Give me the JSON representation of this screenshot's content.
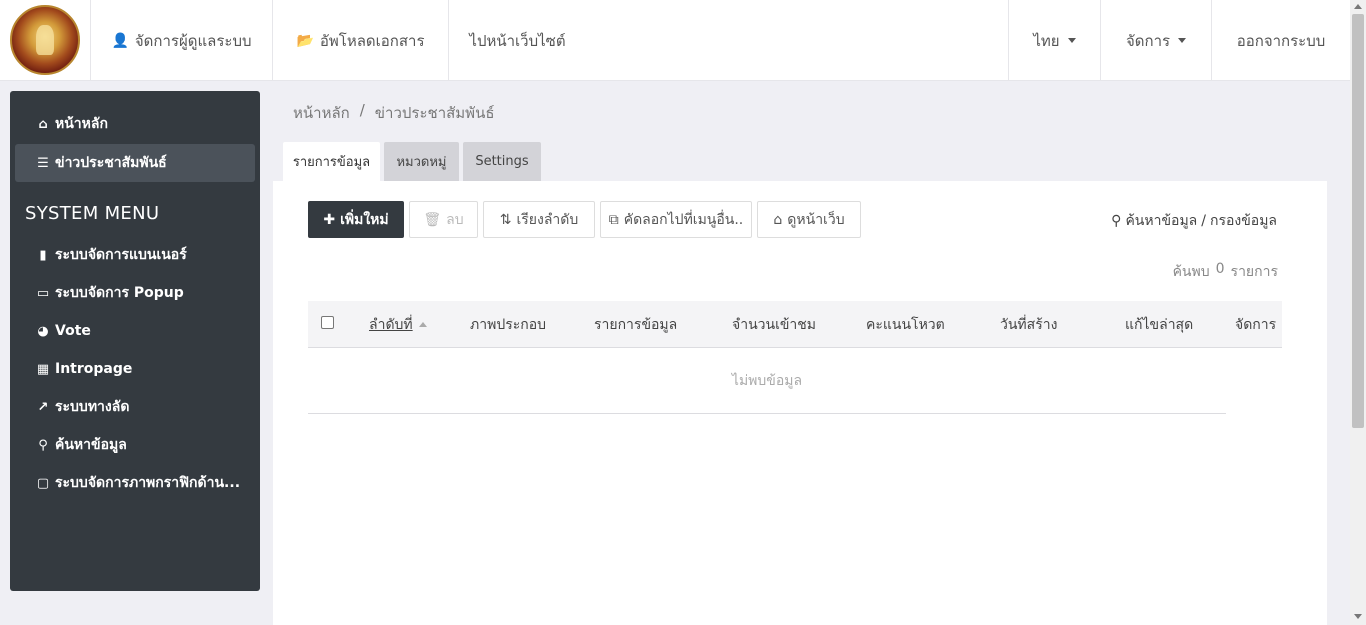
{
  "header": {
    "nav": [
      {
        "label": "จัดการผู้ดูแลระบบ",
        "icon": "user-icon"
      },
      {
        "label": "อัพโหลดเอกสาร",
        "icon": "folder-open-icon"
      },
      {
        "label": "ไปหน้าเว็บไซต์"
      }
    ],
    "language": "ไทย",
    "manage": "จัดการ",
    "logout": "ออกจากระบบ"
  },
  "sidebar": {
    "top_items": [
      {
        "label": "หน้าหลัก",
        "icon": "home-icon"
      },
      {
        "label": "ข่าวประชาสัมพันธ์",
        "icon": "bars-icon"
      }
    ],
    "heading": "SYSTEM MENU",
    "menu_items": [
      {
        "label": "ระบบจัดการแบนเนอร์",
        "icon": "bookmark-icon"
      },
      {
        "label": "ระบบจัดการ Popup",
        "icon": "laptop-icon"
      },
      {
        "label": "Vote",
        "icon": "pie-chart-icon"
      },
      {
        "label": "Intropage",
        "icon": "image-icon"
      },
      {
        "label": "ระบบทางลัด",
        "icon": "external-link-icon"
      },
      {
        "label": "ค้นหาข้อมูล",
        "icon": "search-icon"
      },
      {
        "label": "ระบบจัดการภาพกราฟิกด้าน...",
        "icon": "desktop-icon"
      }
    ]
  },
  "breadcrumb": {
    "home": "หน้าหลัก",
    "separator": "/",
    "current": "ข่าวประชาสัมพันธ์"
  },
  "tabs": [
    "รายการข้อมูล",
    "หมวดหมู่",
    "Settings"
  ],
  "toolbar": {
    "add": "เพิ่มใหม่",
    "delete": "ลบ",
    "sort": "เรียงลำดับ",
    "copy": "คัดลอกไปที่เมนูอื่น..",
    "view": "ดูหน้าเว็บ"
  },
  "search": {
    "label": "ค้นหาข้อมูล",
    "separator": "/",
    "filter": "กรองข้อมูล"
  },
  "result": {
    "prefix": "ค้นพบ",
    "count": "0",
    "suffix": "รายการ"
  },
  "table": {
    "columns": [
      "ลำดับที่",
      "ภาพประกอบ",
      "รายการข้อมูล",
      "จำนวนเข้าชม",
      "คะแนนโหวต",
      "วันที่สร้าง",
      "แก้ไขล่าสุด",
      "จัดการ"
    ],
    "empty_message": "ไม่พบข้อมูล"
  }
}
